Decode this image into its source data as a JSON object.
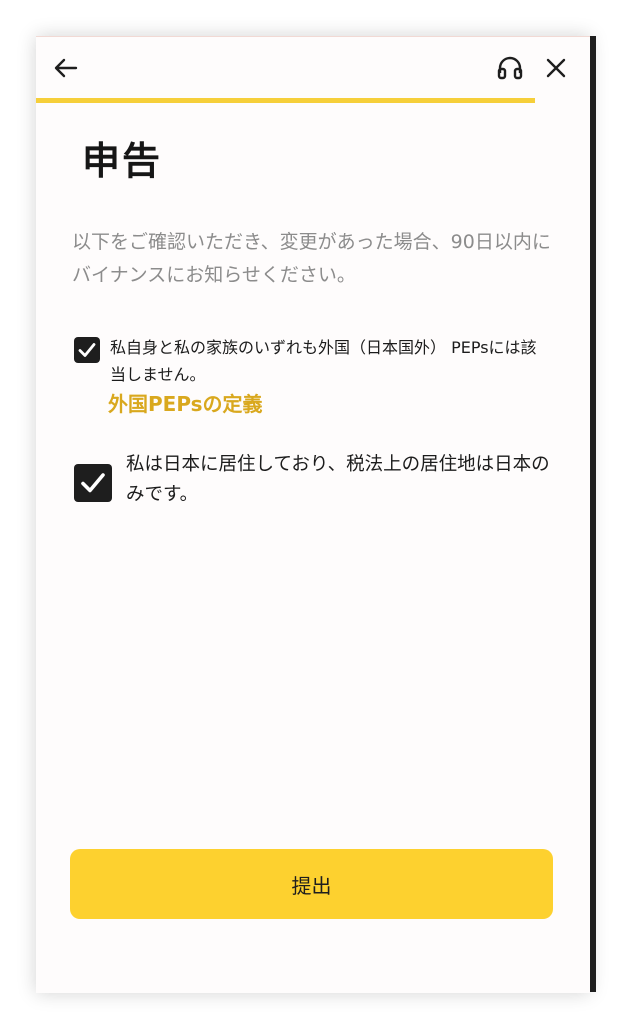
{
  "header": {
    "back_icon": "arrow-left-icon",
    "support_icon": "headset-icon",
    "close_icon": "close-icon"
  },
  "progress": {
    "value_percent": 90,
    "color": "#f6cf3a"
  },
  "page": {
    "title": "申告",
    "notice": "以下をご確認いただき、変更があった場合、90日以内にバイナンスにお知らせください。"
  },
  "declarations": [
    {
      "text": "私自身と私の家族のいずれも外国（日本国外） PEPsには該当しません。",
      "checked": true,
      "link_text": "外国PEPsの定義"
    },
    {
      "text": "私は日本に居住しており、税法上の居住地は日本のみです。",
      "checked": true
    }
  ],
  "submit": {
    "label": "提出",
    "color": "#fdd12f"
  },
  "colors": {
    "accent_link": "#d9a81e",
    "checkbox": "#1e1e1e",
    "notice_text": "#8c8c8c"
  }
}
